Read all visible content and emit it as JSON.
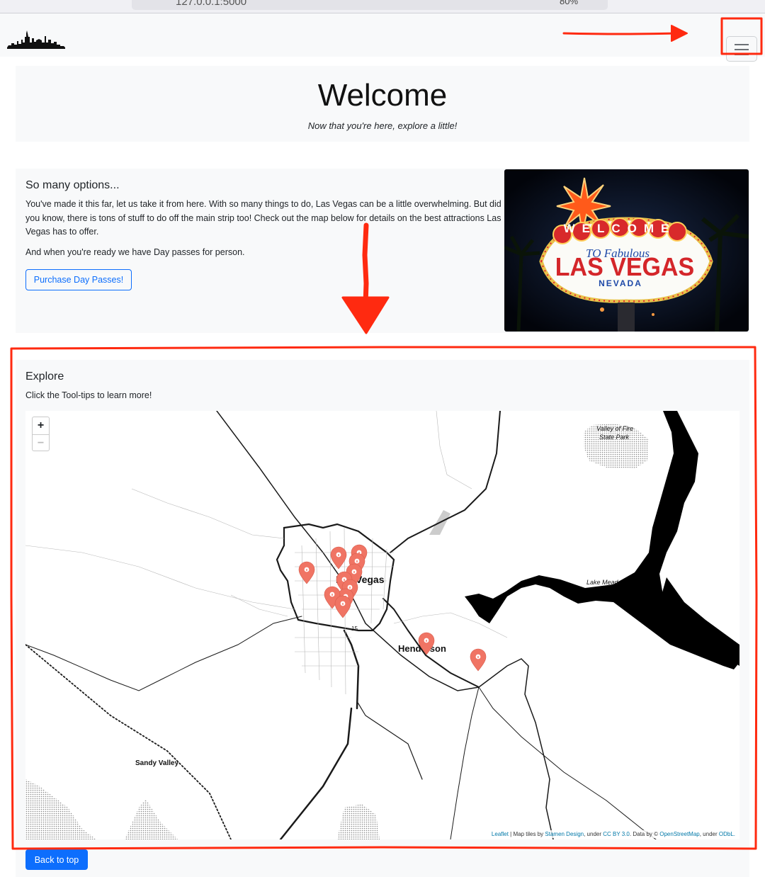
{
  "browser": {
    "url": "127.0.0.1:5000",
    "zoom": "80%"
  },
  "welcome": {
    "title": "Welcome",
    "subtitle": "Now that you're here, explore a little!"
  },
  "options": {
    "heading": "So many options...",
    "paragraph": "You've made it this far, let us take it from here. With so many things to do, Las Vegas can be a little overwhelming. But did you know, there is tons of stuff to do off the main strip too! Check out the map below for details on the best attractions Las Vegas has to offer.",
    "paragraph2": "And when you're ready we have Day passes for person.",
    "button": "Purchase Day Passes!"
  },
  "sign": {
    "line1": "WELCOME",
    "line2": "TO Fabulous",
    "line3": "LAS VEGAS",
    "line4": "NEVADA"
  },
  "explore": {
    "heading": "Explore",
    "text": "Click the Tool-tips to learn more!"
  },
  "map": {
    "zoom_in": "+",
    "zoom_out": "−",
    "labels": {
      "las_vegas": "Las Vegas",
      "henderson": "Henderson",
      "sandy_valley": "Sandy Valley",
      "lake_mead": "Lake Mead",
      "valley_of_fire_1": "Valley of Fire",
      "valley_of_fire_2": "State Park",
      "route": "15"
    },
    "attribution": {
      "leaflet": "Leaflet",
      "sep1": " | Map tiles by ",
      "stamen": "Stamen Design",
      "sep2": ", under ",
      "ccby": "CC BY 3.0",
      "sep3": ". Data by © ",
      "osm": "OpenStreetMap",
      "sep4": ", under ",
      "odbl": "ODbL."
    },
    "marker_count": 12
  },
  "back_to_top": "Back to top",
  "colors": {
    "primary": "#0d6efd",
    "marker": "#f07464",
    "annotation": "#ff2a10"
  }
}
